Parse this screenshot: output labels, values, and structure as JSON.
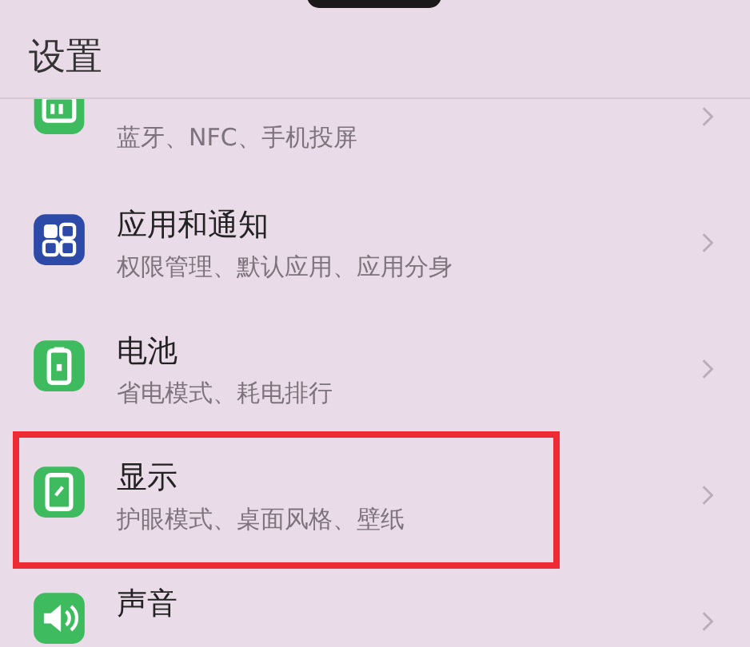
{
  "header": {
    "title": "设置"
  },
  "items": [
    {
      "kind": "connection",
      "subtitle": "蓝牙、NFC、手机投屏",
      "highlighted": false
    },
    {
      "kind": "apps",
      "title": "应用和通知",
      "subtitle": "权限管理、默认应用、应用分身",
      "highlighted": false
    },
    {
      "kind": "battery",
      "title": "电池",
      "subtitle": "省电模式、耗电排行",
      "highlighted": false
    },
    {
      "kind": "display",
      "title": "显示",
      "subtitle": "护眼模式、桌面风格、壁纸",
      "highlighted": true
    },
    {
      "kind": "sound",
      "title": "声音",
      "highlighted": false
    }
  ]
}
